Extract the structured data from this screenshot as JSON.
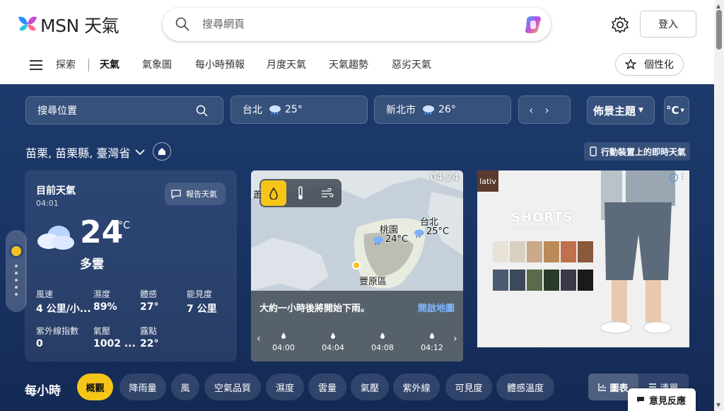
{
  "header": {
    "logo_text": "MSN 天氣",
    "search_placeholder": "搜尋網頁",
    "login_label": "登入"
  },
  "nav": {
    "items": [
      "探索",
      "天氣",
      "氣象圖",
      "每小時預報",
      "月度天氣",
      "天氣趨勢",
      "惡劣天氣"
    ],
    "active": "天氣",
    "personalize_label": "個性化"
  },
  "toolbar": {
    "location_search_placeholder": "搜尋位置",
    "cities": [
      {
        "name": "台北",
        "temp": "25°"
      },
      {
        "name": "新北市",
        "temp": "26°"
      }
    ],
    "prev_arrow": "‹",
    "next_arrow": "›",
    "theme_label": "佈景主題",
    "unit_label": "°C"
  },
  "location": {
    "name": "苗栗, 苗栗縣, 臺灣省",
    "mobile_label": "行動裝置上的即時天氣"
  },
  "current": {
    "title": "目前天氣",
    "time": "04:01",
    "report_label": "報告天氣",
    "temperature": "24",
    "unit": "°C",
    "condition": "多雲",
    "stats": [
      {
        "label": "風速",
        "value": "4 公里/小..."
      },
      {
        "label": "濕度",
        "value": "89%"
      },
      {
        "label": "體感",
        "value": "27°"
      },
      {
        "label": "能見度",
        "value": "7 公里"
      },
      {
        "label": "紫外線指數",
        "value": "0"
      },
      {
        "label": "氣壓",
        "value": "1002 ..."
      },
      {
        "label": "露點",
        "value": "22°"
      }
    ]
  },
  "map": {
    "time": "04:24",
    "labels": [
      {
        "text": "桃園"
      },
      {
        "text": "24°C"
      },
      {
        "text": "台北"
      },
      {
        "text": "25°C"
      },
      {
        "text": "豐原區"
      },
      {
        "text": "24°C"
      },
      {
        "text": "蕭"
      }
    ],
    "message": "大約一小時後將開始下雨。",
    "open_label": "開啟地圖",
    "timeline": [
      "04:00",
      "04:04",
      "04:08",
      "04:12"
    ]
  },
  "ad": {
    "brand": "lativ",
    "headline": "SHORTS",
    "subline": "2023 COLLECTION",
    "colors": [
      "#e8e2d6",
      "#d8d0c0",
      "#c9a98a",
      "#b98a5a",
      "#c0704a",
      "#8a5a3a",
      "#4a5a70",
      "#3a4a5a",
      "#5a6a4a",
      "#2a3a2a",
      "#3a3a4a",
      "#1a1a1a"
    ]
  },
  "hourly": {
    "title": "每小時",
    "chips": [
      "概觀",
      "降雨量",
      "風",
      "空氣品質",
      "濕度",
      "雲量",
      "氣壓",
      "紫外線",
      "可見度",
      "體感溫度"
    ],
    "active_chip": "概觀",
    "view_chart": "圖表",
    "view_list": "清單"
  },
  "feedback_label": "意見反應",
  "colors": {
    "accent": "#f5c518",
    "bg_top": "#1c3a6b",
    "bg_bottom": "#142a55",
    "link": "#7fb6ff"
  }
}
